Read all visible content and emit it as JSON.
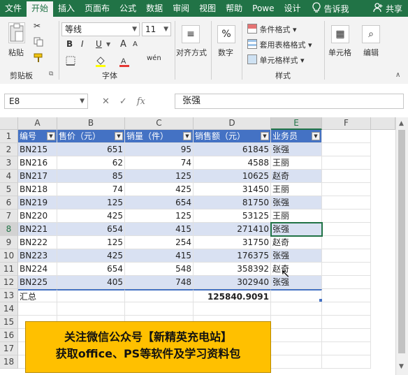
{
  "menubar": {
    "tabs": [
      "文件",
      "开始",
      "插入",
      "页面布",
      "公式",
      "数据",
      "审阅",
      "视图",
      "帮助",
      "Powe",
      "设计"
    ],
    "active_index": 1,
    "tellme": "告诉我",
    "share": "共享"
  },
  "ribbon": {
    "clipboard": {
      "paste": "粘贴",
      "group": "剪贴板"
    },
    "font": {
      "name": "等线",
      "size": "11",
      "bold": "B",
      "italic": "I",
      "underline": "U",
      "group": "字体",
      "grow": "A",
      "shrink": "A",
      "wen": "wén"
    },
    "alignment": {
      "label": "对齐方式"
    },
    "number": {
      "label": "数字",
      "icon": "%"
    },
    "styles": {
      "conditional": "条件格式",
      "table": "套用表格格式",
      "cell": "单元格样式",
      "group": "样式"
    },
    "cells": {
      "label": "单元格"
    },
    "editing": {
      "label": "编辑"
    }
  },
  "formula_bar": {
    "name_box": "E8",
    "cancel": "✕",
    "enter": "✓",
    "fx": "fx",
    "value": "张强"
  },
  "grid": {
    "columns": [
      "A",
      "B",
      "C",
      "D",
      "E",
      "F"
    ],
    "rows": [
      "1",
      "2",
      "3",
      "4",
      "5",
      "6",
      "7",
      "8",
      "9",
      "10",
      "11",
      "12",
      "13",
      "14",
      "15",
      "16",
      "17",
      "18"
    ],
    "selected_column": "E",
    "selected_row": "8",
    "headers": [
      "编号",
      "售价（元）",
      "销量（件）",
      "销售额（元）",
      "业务员"
    ],
    "data": [
      [
        "BN215",
        "651",
        "95",
        "61845",
        "张强"
      ],
      [
        "BN216",
        "62",
        "74",
        "4588",
        "王丽"
      ],
      [
        "BN217",
        "85",
        "125",
        "10625",
        "赵奇"
      ],
      [
        "BN218",
        "74",
        "425",
        "31450",
        "王丽"
      ],
      [
        "BN219",
        "125",
        "654",
        "81750",
        "张强"
      ],
      [
        "BN220",
        "425",
        "125",
        "53125",
        "王丽"
      ],
      [
        "BN221",
        "654",
        "415",
        "271410",
        "张强"
      ],
      [
        "BN222",
        "125",
        "254",
        "31750",
        "赵奇"
      ],
      [
        "BN223",
        "425",
        "415",
        "176375",
        "张强"
      ],
      [
        "BN224",
        "654",
        "548",
        "358392",
        "赵奇"
      ],
      [
        "BN225",
        "405",
        "748",
        "302940",
        "张强"
      ]
    ],
    "total": {
      "label": "汇总",
      "value": "125840.9091"
    }
  },
  "banner": {
    "line1": "关注微信公众号【新精英充电站】",
    "line2": "获取office、PS等软件及学习资料包"
  }
}
